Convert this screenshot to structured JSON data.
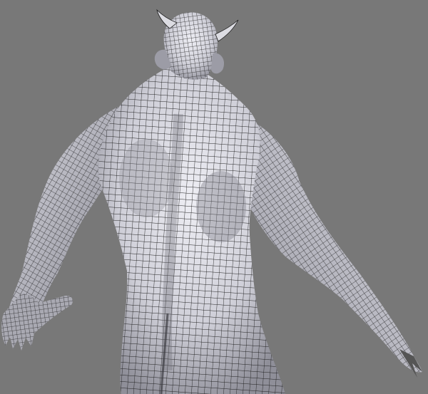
{
  "viewport": {
    "background_color": "#787878",
    "mesh_fill_color": "#d6d6de",
    "mesh_shade_color": "#9c9ca6",
    "wire_color": "#1a1a1a"
  },
  "scene": {
    "subject": "horned-creature-back-view-wireframe",
    "display_mode": "wireframe-on-shaded"
  }
}
